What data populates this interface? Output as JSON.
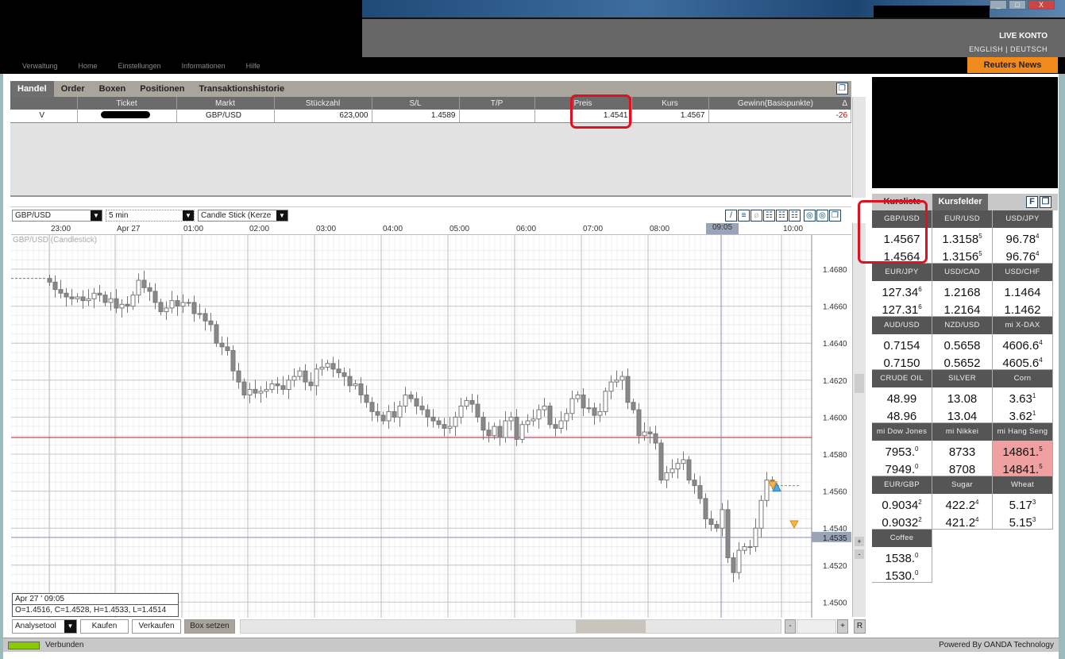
{
  "header": {
    "account_label": "LIVE KONTO",
    "lang_english": "ENGLISH",
    "lang_sep": "|",
    "lang_deutsch": "DEUTSCH",
    "news_button": "Reuters News",
    "window_buttons": [
      "_",
      "□",
      "X"
    ],
    "nav": [
      "Verwaltung",
      "Home",
      "Einstellungen",
      "Informationen",
      "Hilfe"
    ]
  },
  "trades": {
    "tabs": [
      "Handel",
      "Order",
      "Boxen",
      "Positionen",
      "Transaktionshistorie"
    ],
    "columns": [
      "",
      "Ticket",
      "Markt",
      "Stückzahl",
      "S/L",
      "T/P",
      "Preis",
      "Kurs",
      "Gewinn(Basispunkte)"
    ],
    "sort_icon": "Δ",
    "rows": [
      {
        "side": "V",
        "ticket": "",
        "market": "GBP/USD",
        "units": "623,000",
        "sl": "1.4589",
        "tp": "",
        "price": "1.4541",
        "rate": "1.4567",
        "profit": "-26"
      }
    ]
  },
  "chart_toolbar": {
    "instrument": "GBP/USD",
    "interval": "5 min",
    "type": "Candle Stick (Kerze"
  },
  "chart_data": {
    "type": "candlestick",
    "title": "GBP/USD (Candlestick)",
    "x_labels": [
      "23:00",
      "Apr 27",
      "01:00",
      "02:00",
      "03:00",
      "04:00",
      "05:00",
      "06:00",
      "07:00",
      "08:00",
      "09:05",
      "10:00"
    ],
    "interval_minutes": 5,
    "first_open": 1.4675,
    "closes": [
      1.4673,
      1.4669,
      1.4667,
      1.4665,
      1.4664,
      1.4665,
      1.4663,
      1.4664,
      1.4667,
      1.4666,
      1.4662,
      1.4664,
      1.4659,
      1.4661,
      1.466,
      1.4666,
      1.4674,
      1.467,
      1.4668,
      1.4662,
      1.4657,
      1.4659,
      1.4663,
      1.466,
      1.4662,
      1.4662,
      1.4656,
      1.4656,
      1.4652,
      1.465,
      1.464,
      1.4638,
      1.4636,
      1.4625,
      1.4619,
      1.4612,
      1.4615,
      1.4613,
      1.4614,
      1.4615,
      1.4618,
      1.4617,
      1.4615,
      1.462,
      1.4622,
      1.4625,
      1.4619,
      1.4617,
      1.4626,
      1.4627,
      1.4629,
      1.4626,
      1.4624,
      1.4622,
      1.4617,
      1.4618,
      1.4612,
      1.4608,
      1.4603,
      1.4601,
      1.4598,
      1.4603,
      1.46,
      1.4606,
      1.4612,
      1.461,
      1.4606,
      1.4604,
      1.46,
      1.4598,
      1.4596,
      1.4594,
      1.4595,
      1.46,
      1.4606,
      1.4609,
      1.4607,
      1.46,
      1.4593,
      1.459,
      1.4595,
      1.4589,
      1.4598,
      1.46,
      1.4588,
      1.4596,
      1.4598,
      1.4599,
      1.4604,
      1.4606,
      1.4596,
      1.4594,
      1.4598,
      1.4602,
      1.461,
      1.4612,
      1.4605,
      1.4605,
      1.4601,
      1.4603,
      1.4614,
      1.4619,
      1.462,
      1.4622,
      1.4608,
      1.4604,
      1.459,
      1.4592,
      1.4591,
      1.4586,
      1.4566,
      1.457,
      1.4572,
      1.4575,
      1.4577,
      1.4566,
      1.4563,
      1.4556,
      1.4545,
      1.4542,
      1.454,
      1.455,
      1.4524,
      1.4516,
      1.4528,
      1.453,
      1.453,
      1.454,
      1.4555,
      1.4566,
      1.4563
    ],
    "y_ticks": [
      "1.4680",
      "1.4660",
      "1.4640",
      "1.4620",
      "1.4600",
      "1.4580",
      "1.4560",
      "1.4540",
      "1.4520",
      "1.4500"
    ],
    "ylim": [
      1.4497,
      1.4693
    ],
    "stop_loss_line": 1.4589,
    "cursor_price": "1.4535",
    "cursor_time": "09:05",
    "tooltip": {
      "time": "Apr 27 ' 09:05",
      "ohlc": "O=1.4516, C=1.4528, H=1.4533, L=1.4514"
    }
  },
  "bottom_toolbar": {
    "analysis": "Analysetool",
    "buy": "Kaufen",
    "sell": "Verkaufen",
    "box": "Box setzen",
    "reset": "R"
  },
  "status": {
    "connection": "Verbunden",
    "powered": "Powered By OANDA Technology",
    "connection_color": "#88cc00"
  },
  "rates": {
    "tabs": [
      "Kursliste",
      "Kursfelder"
    ],
    "f_button": "F",
    "cells": [
      {
        "name": "GBP/USD",
        "bid": "1.4567",
        "ask": "1.4564",
        "sup": ""
      },
      {
        "name": "EUR/USD",
        "bid": "1.3158",
        "ask": "1.3156",
        "sup": "5"
      },
      {
        "name": "USD/JPY",
        "bid": "96.78",
        "ask": "96.76",
        "sup": "4"
      },
      {
        "name": "EUR/JPY",
        "bid": "127.34",
        "ask": "127.31",
        "sup": "6"
      },
      {
        "name": "USD/CAD",
        "bid": "1.2168",
        "ask": "1.2164",
        "sup": ""
      },
      {
        "name": "USD/CHF",
        "bid": "1.1464",
        "ask": "1.1462",
        "sup": ""
      },
      {
        "name": "AUD/USD",
        "bid": "0.7154",
        "ask": "0.7150",
        "sup": ""
      },
      {
        "name": "NZD/USD",
        "bid": "0.5658",
        "ask": "0.5652",
        "sup": ""
      },
      {
        "name": "mi X-DAX",
        "bid": "4606.6",
        "ask": "4605.6",
        "sup": "4"
      },
      {
        "name": "CRUDE OIL",
        "bid": "48.99",
        "ask": "48.96",
        "sup": ""
      },
      {
        "name": "SILVER",
        "bid": "13.08",
        "ask": "13.04",
        "sup": ""
      },
      {
        "name": "Corn",
        "bid": "3.63",
        "ask": "3.62",
        "sup": "1"
      },
      {
        "name": "mi Dow Jones",
        "bid": "7953.",
        "ask": "7949.",
        "sup": "0"
      },
      {
        "name": "mi Nikkei",
        "bid": "8733",
        "ask": "8708",
        "sup": ""
      },
      {
        "name": "mi Hang Seng",
        "bid": "14861.",
        "ask": "14841.",
        "sup": "5",
        "highlight": true
      },
      {
        "name": "EUR/GBP",
        "bid": "0.9034",
        "ask": "0.9032",
        "sup": "2"
      },
      {
        "name": "Sugar",
        "bid": "422.2",
        "ask": "421.2",
        "sup": "4"
      },
      {
        "name": "Wheat",
        "bid": "5.17",
        "ask": "5.15",
        "sup": "3"
      },
      {
        "name": "Coffee",
        "bid": "1538.",
        "ask": "1530.",
        "sup": "0"
      }
    ]
  }
}
